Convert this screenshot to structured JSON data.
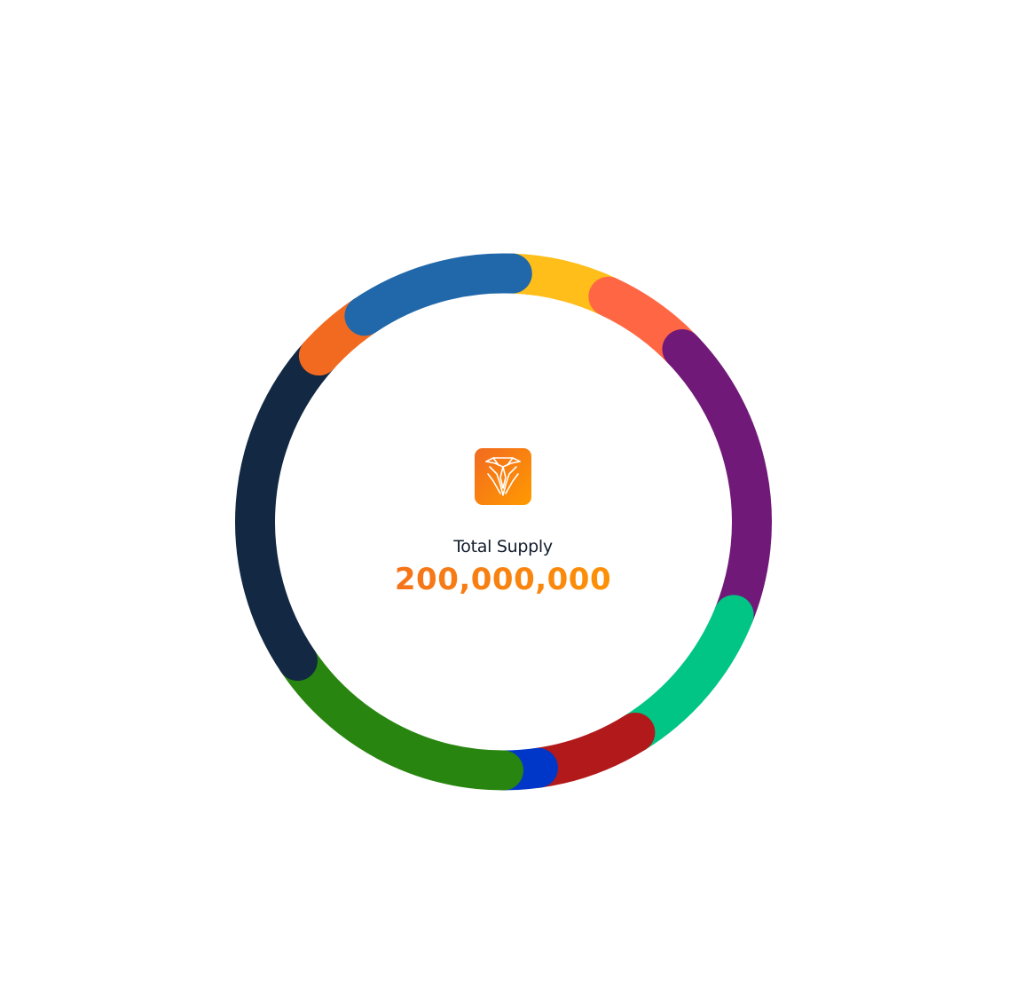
{
  "center": {
    "label": "Total Supply",
    "value": "200,000,000",
    "logo_icon": "lion-logo-icon",
    "logo_gradient": [
      "#f26a20",
      "#ff9a00"
    ]
  },
  "chart_data": {
    "type": "pie",
    "style": "donut",
    "start_angle_deg": 0,
    "direction": "clockwise",
    "slices": [
      {
        "color": "#ffbe1a",
        "start_deg": 2,
        "end_deg": 25
      },
      {
        "color": "#ff6744",
        "start_deg": 25,
        "end_deg": 46
      },
      {
        "color": "#701978",
        "start_deg": 46,
        "end_deg": 112
      },
      {
        "color": "#00c584",
        "start_deg": 112,
        "end_deg": 148
      },
      {
        "color": "#b2191b",
        "start_deg": 148,
        "end_deg": 172
      },
      {
        "color": "#0037c8",
        "start_deg": 172,
        "end_deg": 180
      },
      {
        "color": "#28850f",
        "start_deg": 180,
        "end_deg": 236
      },
      {
        "color": "#122843",
        "start_deg": 236,
        "end_deg": 312
      },
      {
        "color": "#f26a20",
        "start_deg": 312,
        "end_deg": 326
      },
      {
        "color": "#2168aa",
        "start_deg": 326,
        "end_deg": 362
      }
    ]
  }
}
